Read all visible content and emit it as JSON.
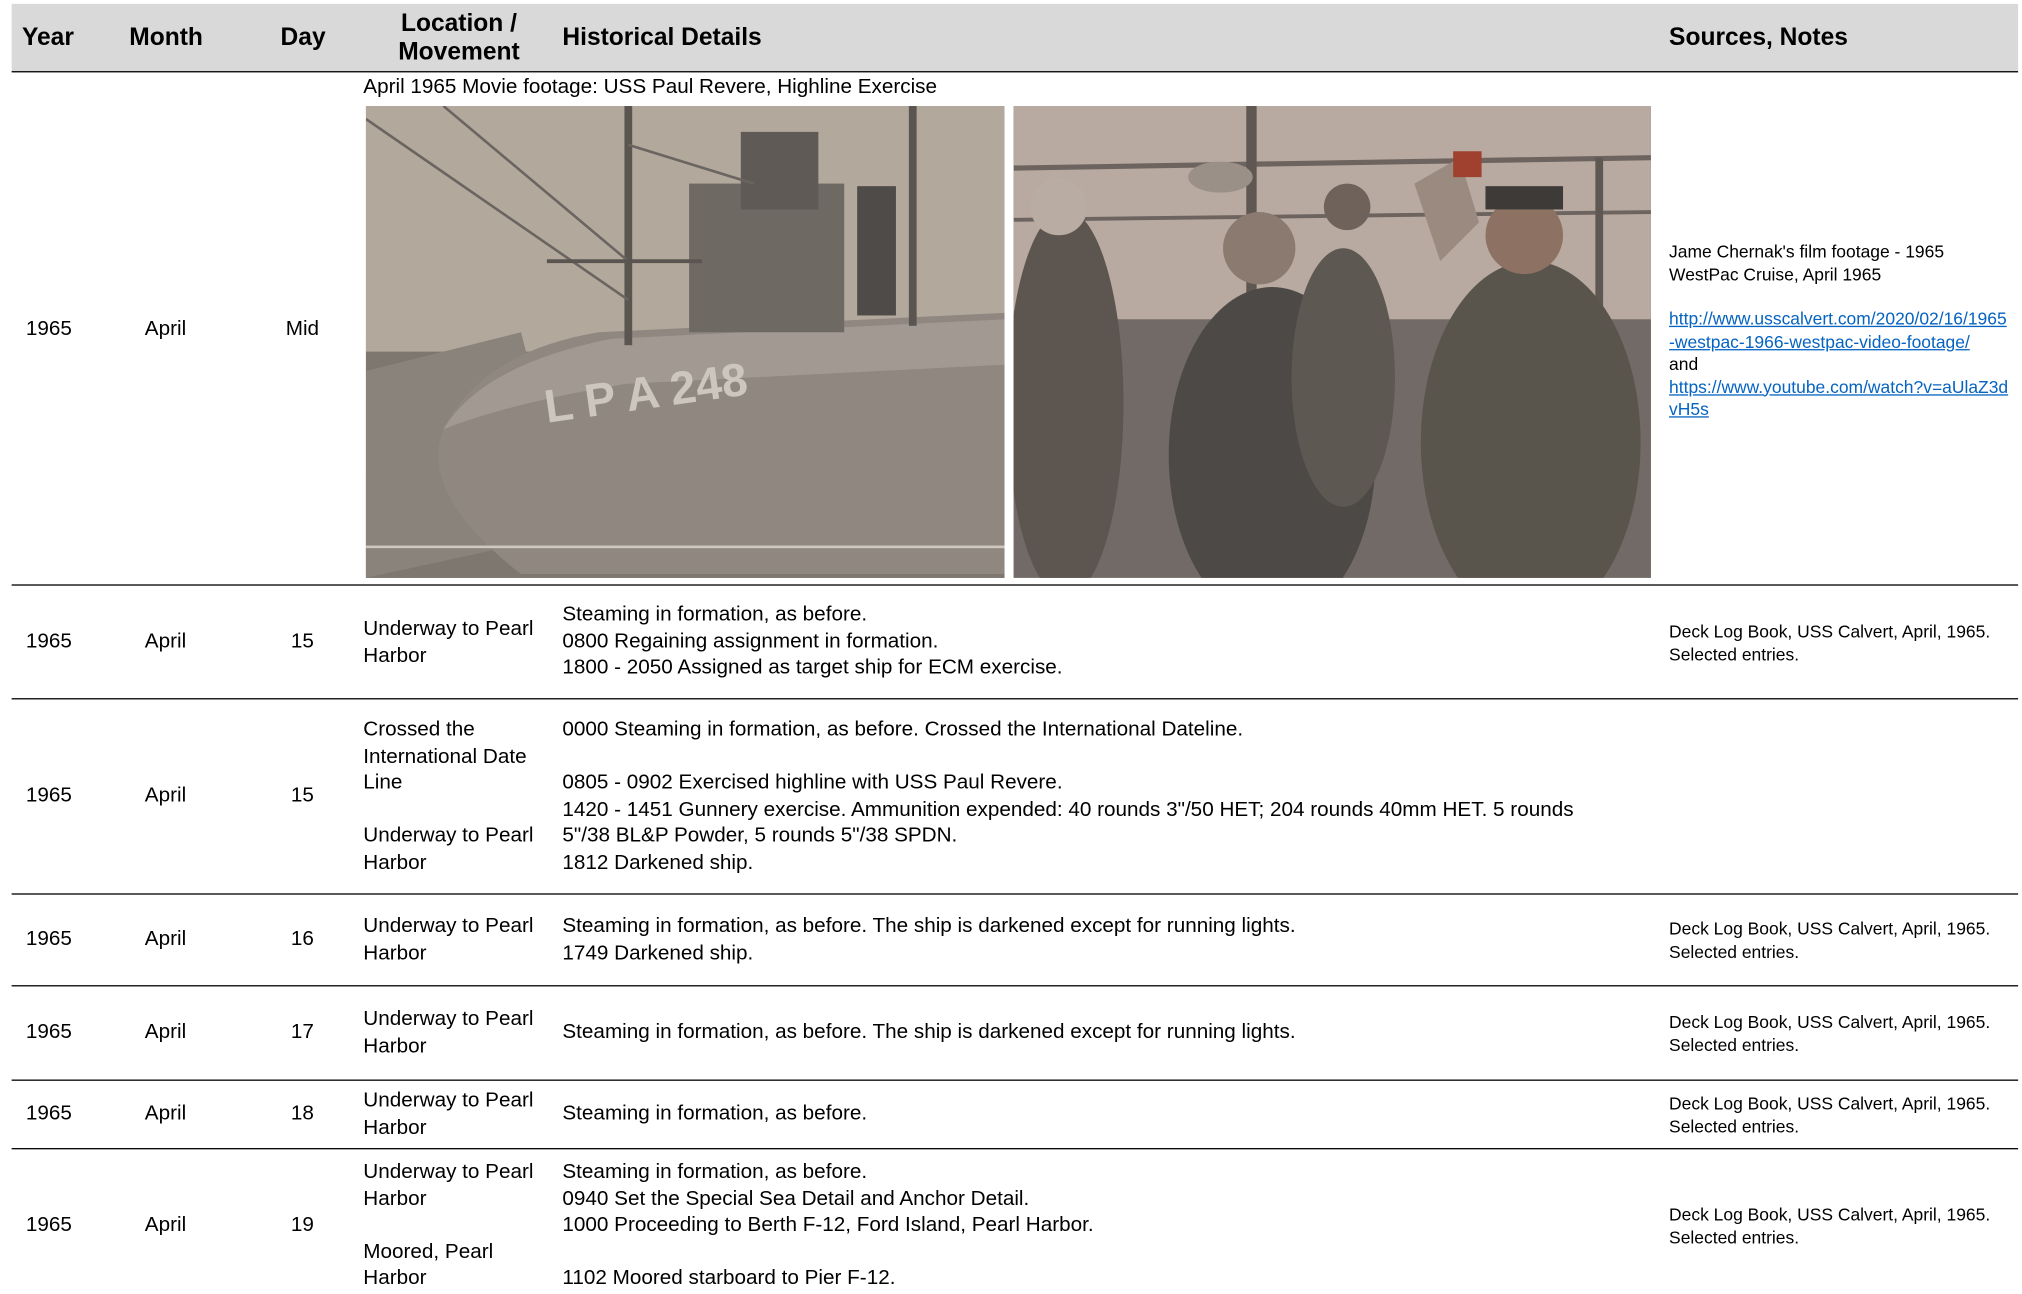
{
  "header": {
    "year": "Year",
    "month": "Month",
    "day": "Day",
    "location": "Location /\nMovement",
    "details": "Historical Details",
    "sources": "Sources, Notes"
  },
  "media_row": {
    "year": "1965",
    "month": "April",
    "day": "Mid",
    "caption": "April 1965 Movie footage: USS Paul Revere, Highline Exercise",
    "photo_left_hull_number": "L P A 248",
    "source_text": "Jame Chernak's film footage - 1965 WestPac Cruise, April 1965",
    "link1": "http://www.usscalvert.com/2020/02/16/1965-westpac-1966-westpac-video-footage/",
    "and": "and",
    "link2": "https://www.youtube.com/watch?v=aUlaZ3dvH5s"
  },
  "rows": [
    {
      "year": "1965",
      "month": "April",
      "day": "15",
      "location": "Underway to Pearl\nHarbor",
      "details": "Steaming in formation, as before.\n0800 Regaining assignment in formation.\n1800 - 2050 Assigned as target ship for ECM exercise.",
      "source": "Deck Log Book, USS Calvert, April, 1965.\nSelected entries."
    },
    {
      "year": "1965",
      "month": "April",
      "day": "15",
      "location": "Crossed the\nInternational Date\nLine\n\nUnderway to Pearl\nHarbor",
      "details": "0000 Steaming in formation, as before. Crossed the International Dateline.\n\n0805 - 0902 Exercised highline with USS Paul Revere.\n1420 - 1451 Gunnery exercise. Ammunition expended: 40 rounds 3\"/50 HET; 204 rounds 40mm HET. 5 rounds\n5\"/38 BL&P Powder, 5 rounds 5\"/38 SPDN.\n1812 Darkened ship.",
      "source": ""
    },
    {
      "year": "1965",
      "month": "April",
      "day": "16",
      "location": "Underway to Pearl\nHarbor",
      "details": "Steaming in formation, as before. The ship is darkened except for running lights.\n1749 Darkened ship.",
      "source": "Deck Log Book, USS Calvert, April, 1965.\nSelected entries."
    },
    {
      "year": "1965",
      "month": "April",
      "day": "17",
      "location": "Underway to Pearl\nHarbor",
      "details": "Steaming in formation, as before. The ship is darkened except for running lights.",
      "source": "Deck Log Book, USS Calvert, April, 1965.\nSelected entries."
    },
    {
      "year": "1965",
      "month": "April",
      "day": "18",
      "location": "Underway to Pearl\nHarbor",
      "details": "Steaming in formation, as before.",
      "source": "Deck Log Book, USS Calvert, April, 1965.\nSelected entries."
    },
    {
      "year": "1965",
      "month": "April",
      "day": "19",
      "location": "Underway to Pearl\nHarbor\n\nMoored, Pearl\nHarbor",
      "details": "Steaming in formation, as before.\n0940 Set the Special Sea Detail and Anchor Detail.\n1000 Proceeding to Berth F-12, Ford Island, Pearl Harbor.\n\n1102 Moored starboard to Pier F-12.",
      "source": "Deck Log Book, USS Calvert, April, 1965.\nSelected entries."
    }
  ]
}
